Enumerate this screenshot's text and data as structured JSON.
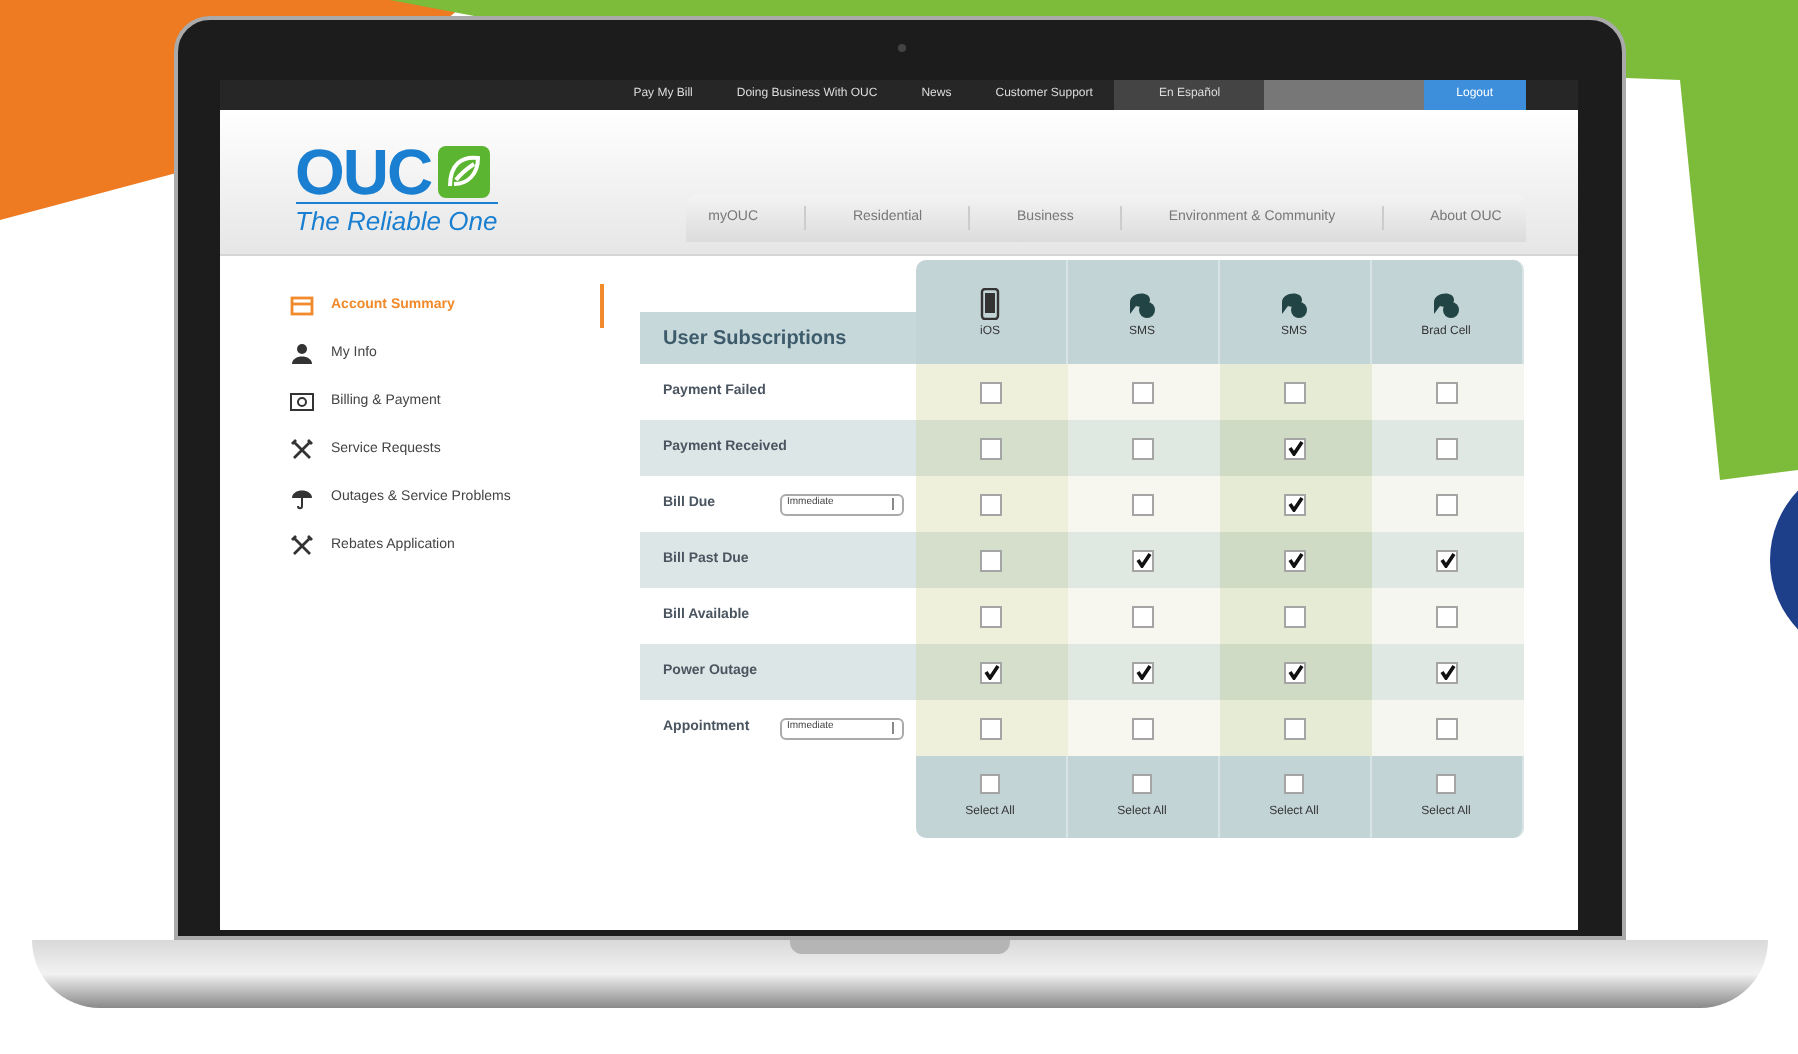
{
  "top_nav": [
    {
      "label": "Pay My Bill"
    },
    {
      "label": "Doing Business With OUC"
    },
    {
      "label": "News"
    },
    {
      "label": "Customer Support"
    }
  ],
  "language": "En Español",
  "logout": "Logout",
  "logo": {
    "name": "OUC",
    "tagline": "The Reliable One"
  },
  "main_nav": [
    {
      "label": "myOUC"
    },
    {
      "label": "Residential"
    },
    {
      "label": "Business"
    },
    {
      "label": "Environment & Community"
    },
    {
      "label": "About OUC"
    }
  ],
  "sidebar": [
    {
      "label": "Account Summary",
      "selected": true,
      "kind": "card"
    },
    {
      "label": "My Info",
      "selected": false,
      "kind": "person"
    },
    {
      "label": "Billing & Payment",
      "selected": false,
      "kind": "bill"
    },
    {
      "label": "Service Requests",
      "selected": false,
      "kind": "tools"
    },
    {
      "label": "Outages & Service Problems",
      "selected": false,
      "kind": "umbrella"
    },
    {
      "label": "Rebates Application",
      "selected": false,
      "kind": "tools"
    }
  ],
  "subscriptions": {
    "title": "User Subscriptions",
    "columns": [
      {
        "label": "iOS",
        "kind": "phone"
      },
      {
        "label": "SMS",
        "kind": "chat"
      },
      {
        "label": "SMS",
        "kind": "chat"
      },
      {
        "label": "Brad Cell",
        "kind": "chat"
      }
    ],
    "rows": [
      {
        "label": "Payment Failed",
        "checks": [
          false,
          false,
          false,
          false
        ]
      },
      {
        "label": "Payment Received",
        "checks": [
          false,
          false,
          true,
          false
        ]
      },
      {
        "label": "Bill Due",
        "frequency": "Immediate",
        "checks": [
          false,
          false,
          true,
          false
        ]
      },
      {
        "label": "Bill Past Due",
        "checks": [
          false,
          true,
          true,
          true
        ]
      },
      {
        "label": "Bill Available",
        "checks": [
          false,
          false,
          false,
          false
        ]
      },
      {
        "label": "Power Outage",
        "checks": [
          true,
          true,
          true,
          true
        ]
      },
      {
        "label": "Appointment",
        "frequency": "Immediate",
        "checks": [
          false,
          false,
          false,
          false
        ]
      }
    ],
    "select_all": [
      {
        "label": "Select All",
        "checked": false
      },
      {
        "label": "Select All",
        "checked": false
      },
      {
        "label": "Select All",
        "checked": false
      },
      {
        "label": "Select All",
        "checked": false
      }
    ]
  }
}
